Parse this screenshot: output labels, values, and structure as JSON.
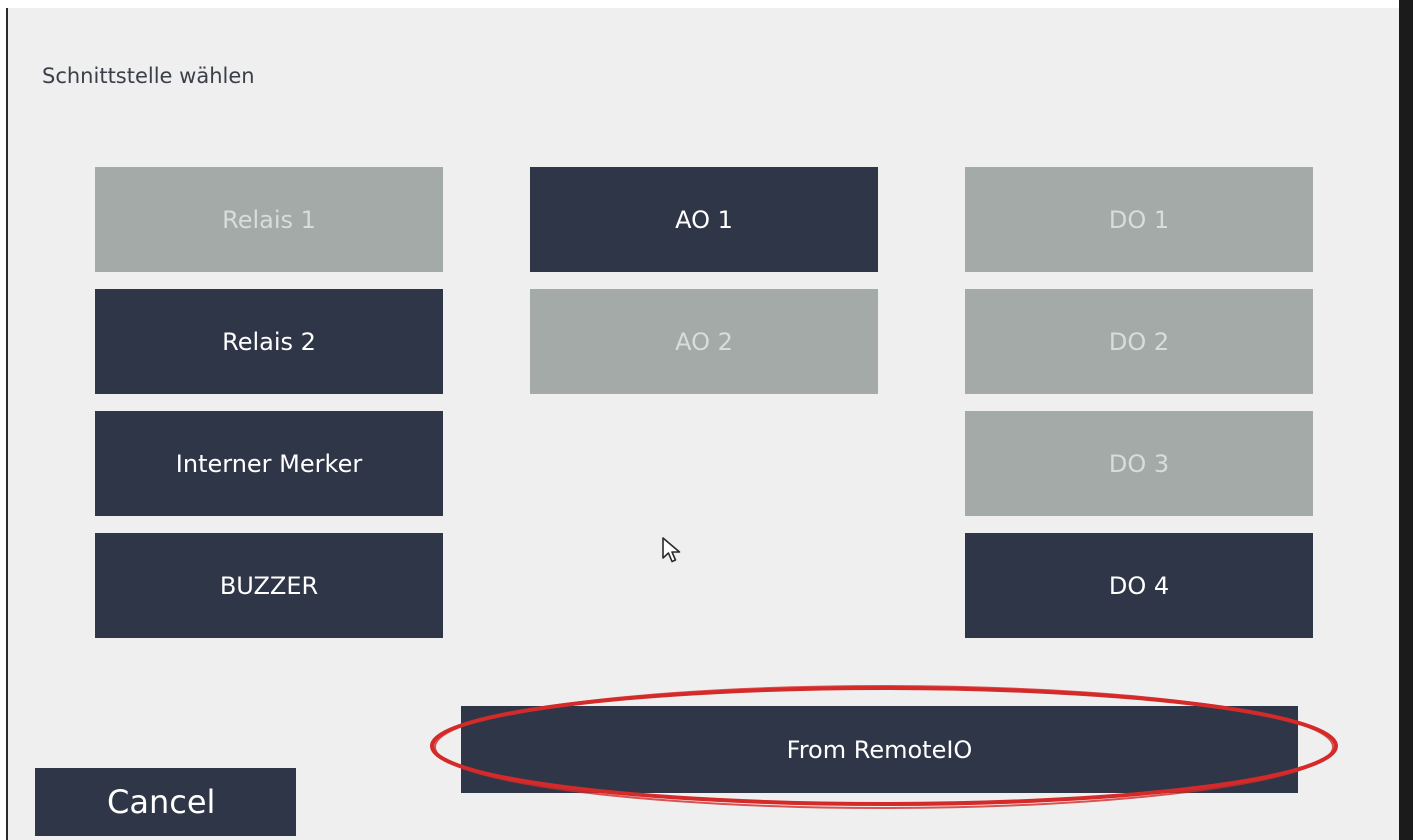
{
  "dialog": {
    "title": "Schnittstelle wählen"
  },
  "columns": {
    "relais": [
      {
        "label": "Relais 1",
        "state": "disabled"
      },
      {
        "label": "Relais 2",
        "state": "active"
      },
      {
        "label": "Interner Merker",
        "state": "active"
      },
      {
        "label": "BUZZER",
        "state": "active"
      }
    ],
    "analog_outputs": [
      {
        "label": "AO 1",
        "state": "active"
      },
      {
        "label": "AO 2",
        "state": "disabled"
      }
    ],
    "digital_outputs": [
      {
        "label": "DO 1",
        "state": "disabled"
      },
      {
        "label": "DO 2",
        "state": "disabled"
      },
      {
        "label": "DO 3",
        "state": "disabled"
      },
      {
        "label": "DO 4",
        "state": "active"
      }
    ]
  },
  "actions": {
    "from_remoteio_label": "From RemoteIO",
    "cancel_label": "Cancel"
  },
  "colors": {
    "button_active": "#2f3647",
    "button_disabled": "#a4aaa8",
    "background": "#efefef",
    "highlight": "#d42a2a"
  },
  "icons": {
    "cursor": "mouse-pointer-icon"
  }
}
